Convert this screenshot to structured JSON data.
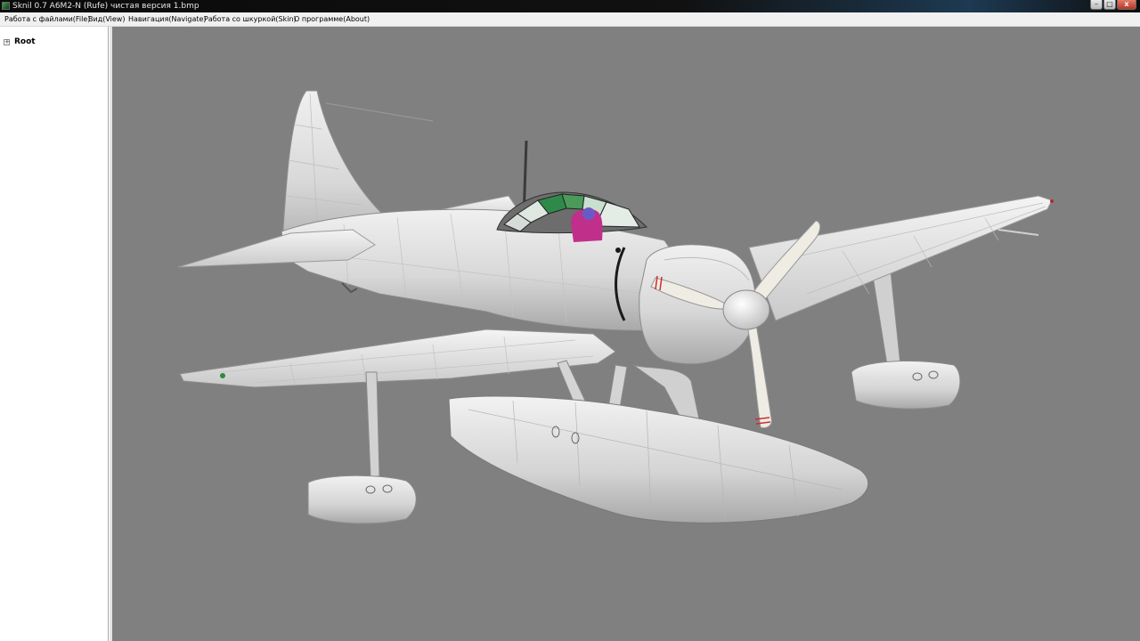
{
  "window": {
    "title": "Sknil 0.7   A6M2-N (Rufe) чистая версия 1.bmp",
    "buttons": {
      "minimize": "–",
      "maximize": "□",
      "close": "x"
    }
  },
  "menu": [
    {
      "label": "Работа с файлами(File)"
    },
    {
      "label": "Вид(View)"
    },
    {
      "label": "Навигация(Navigate)"
    },
    {
      "label": "Работа со шкуркой(Skin)"
    },
    {
      "label": "О программе(About)"
    }
  ],
  "tree": {
    "root": {
      "label": "Root",
      "expander": "+"
    }
  },
  "viewport": {
    "background": "#808080",
    "model_icon": "seaplane-3d-model"
  },
  "colors": {
    "titlebar": "#0a0a0a",
    "menubar": "#f0f0f0",
    "skin": "#e6e6e6",
    "propeller": "#efece4",
    "canopy_green": "#2f8a4a",
    "pilot_magenta": "#c0308a"
  }
}
